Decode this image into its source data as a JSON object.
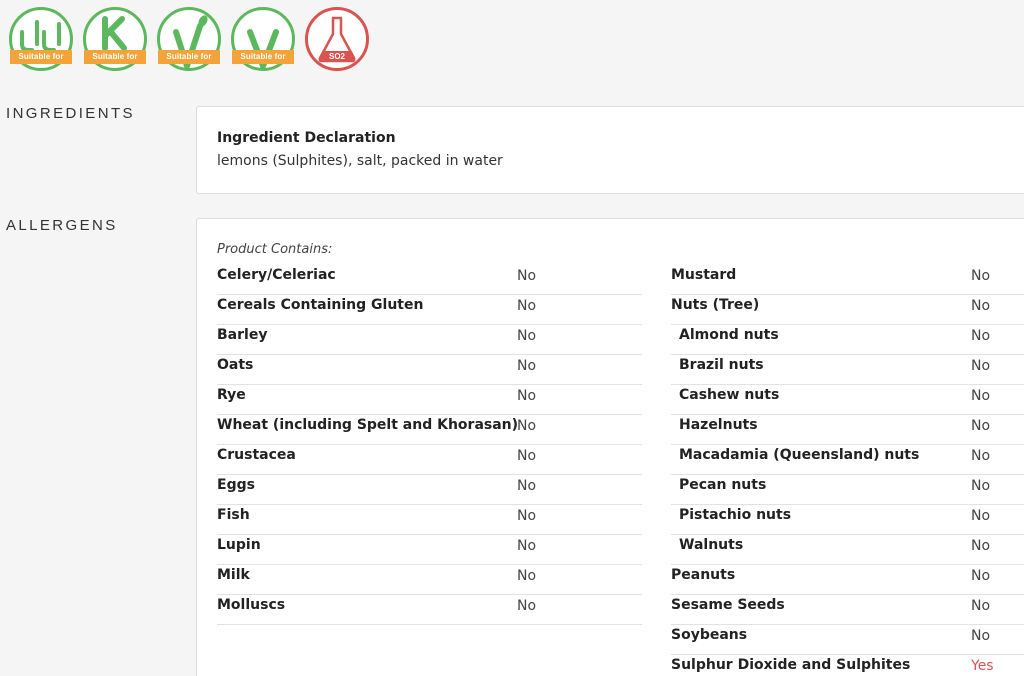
{
  "badges": [
    {
      "icon": "halal-icon",
      "ribbon": "Suitable for",
      "color": "#5cb85c"
    },
    {
      "icon": "kosher-icon",
      "ribbon": "Suitable for",
      "color": "#5cb85c"
    },
    {
      "icon": "vegetarian-icon",
      "ribbon": "Suitable for",
      "color": "#5cb85c"
    },
    {
      "icon": "vegan-icon",
      "ribbon": "Suitable for",
      "color": "#5cb85c"
    },
    {
      "icon": "sulphites-icon",
      "label": "SO2",
      "color": "#d9534f"
    }
  ],
  "ingredients": {
    "section_label": "INGREDIENTS",
    "title": "Ingredient Declaration",
    "text": "lemons (Sulphites), salt, packed in water"
  },
  "allergens": {
    "section_label": "ALLERGENS",
    "contains_label": "Product Contains:",
    "left": [
      {
        "name": "Celery/Celeriac",
        "value": "No"
      },
      {
        "name": "Cereals Containing Gluten",
        "value": "No"
      },
      {
        "name": "Barley",
        "value": "No"
      },
      {
        "name": "Oats",
        "value": "No"
      },
      {
        "name": "Rye",
        "value": "No"
      },
      {
        "name": "Wheat (including Spelt and Khorasan)",
        "value": "No"
      },
      {
        "name": "Crustacea",
        "value": "No"
      },
      {
        "name": "Eggs",
        "value": "No"
      },
      {
        "name": "Fish",
        "value": "No"
      },
      {
        "name": "Lupin",
        "value": "No"
      },
      {
        "name": "Milk",
        "value": "No"
      },
      {
        "name": "Molluscs",
        "value": "No"
      }
    ],
    "right": [
      {
        "name": "Mustard",
        "value": "No"
      },
      {
        "name": "Nuts (Tree)",
        "value": "No"
      },
      {
        "name": "Almond nuts",
        "value": "No"
      },
      {
        "name": "Brazil nuts",
        "value": "No"
      },
      {
        "name": "Cashew nuts",
        "value": "No"
      },
      {
        "name": "Hazelnuts",
        "value": "No"
      },
      {
        "name": "Macadamia (Queensland) nuts",
        "value": "No"
      },
      {
        "name": "Pecan nuts",
        "value": "No"
      },
      {
        "name": "Pistachio nuts",
        "value": "No"
      },
      {
        "name": "Walnuts",
        "value": "No"
      },
      {
        "name": "Peanuts",
        "value": "No"
      },
      {
        "name": "Sesame Seeds",
        "value": "No"
      },
      {
        "name": "Soybeans",
        "value": "No"
      },
      {
        "name": "Sulphur Dioxide and Sulphites",
        "value": "Yes"
      }
    ]
  }
}
